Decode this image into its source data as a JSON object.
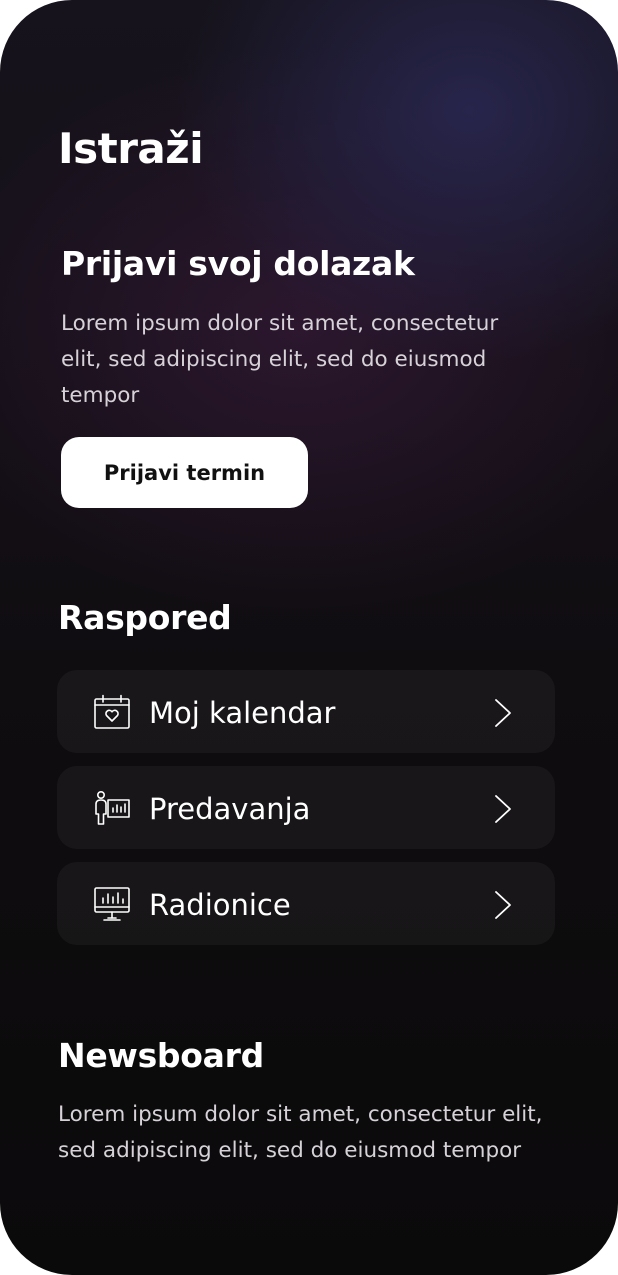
{
  "page": {
    "title": "Istraži"
  },
  "checkin": {
    "title": "Prijavi svoj dolazak",
    "description": "Lorem ipsum dolor sit amet, consectetur elit, sed adipiscing elit, sed do eiusmod tempor",
    "button_label": "Prijavi termin"
  },
  "schedule": {
    "title": "Raspored",
    "items": [
      {
        "label": "Moj kalendar",
        "icon": "calendar-heart-icon"
      },
      {
        "label": "Predavanja",
        "icon": "lecture-presenter-icon"
      },
      {
        "label": "Radionice",
        "icon": "workshop-monitor-icon"
      }
    ]
  },
  "newsboard": {
    "title": "Newsboard",
    "description": "Lorem ipsum dolor sit amet, consectetur  elit, sed adipiscing elit, sed do eiusmod tempor"
  },
  "colors": {
    "background_dark": "#0b0a0b",
    "background_tint": "#2a1a30",
    "button_bg": "#ffffff",
    "card_bg": "#1a181b",
    "text_secondary": "#d6d2d8"
  }
}
